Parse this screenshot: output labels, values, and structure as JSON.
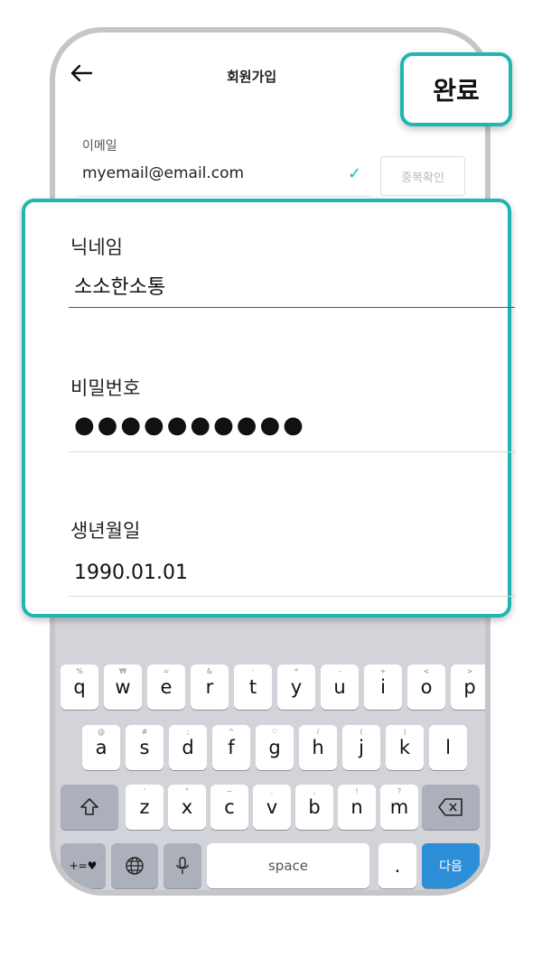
{
  "header": {
    "title": "회원가입",
    "done_label": "완료"
  },
  "email": {
    "label": "이메일",
    "value": "myemail@email.com",
    "dup_check_label": "중복확인"
  },
  "nickname": {
    "label": "닉네임",
    "value": "소소한소통"
  },
  "password": {
    "label": "비밀번호",
    "value": "●●●●●●●●●●"
  },
  "birthdate": {
    "label": "생년월일",
    "value": "1990.01.01"
  },
  "keyboard": {
    "row1": [
      "q",
      "w",
      "e",
      "r",
      "t",
      "y",
      "u",
      "i",
      "o",
      "p"
    ],
    "row1_hints": [
      "%",
      "₩",
      "=",
      "&",
      "·",
      "*",
      "-",
      "+",
      "<",
      ">"
    ],
    "row2": [
      "a",
      "s",
      "d",
      "f",
      "g",
      "h",
      "j",
      "k",
      "l"
    ],
    "row2_hints": [
      "@",
      "#",
      ";",
      "^",
      "♡",
      "/",
      "(",
      ")",
      ""
    ],
    "row3": [
      "z",
      "x",
      "c",
      "v",
      "b",
      "n",
      "m"
    ],
    "row3_hints": [
      "'",
      "\"",
      "~",
      ".",
      ",",
      "!",
      "?"
    ],
    "symbols_label": "+=♥",
    "space_label": "space",
    "period_label": ".",
    "next_label": "다음"
  },
  "colors": {
    "accent": "#1fb5b0",
    "next_key": "#2d8ed8",
    "keyboard_bg": "#d2d4da",
    "frame": "#c6c6ca"
  },
  "icons": {
    "back": "arrow-left-icon",
    "check": "checkmark-icon",
    "shift": "shift-icon",
    "backspace": "backspace-icon",
    "globe": "globe-icon",
    "mic": "microphone-icon"
  }
}
